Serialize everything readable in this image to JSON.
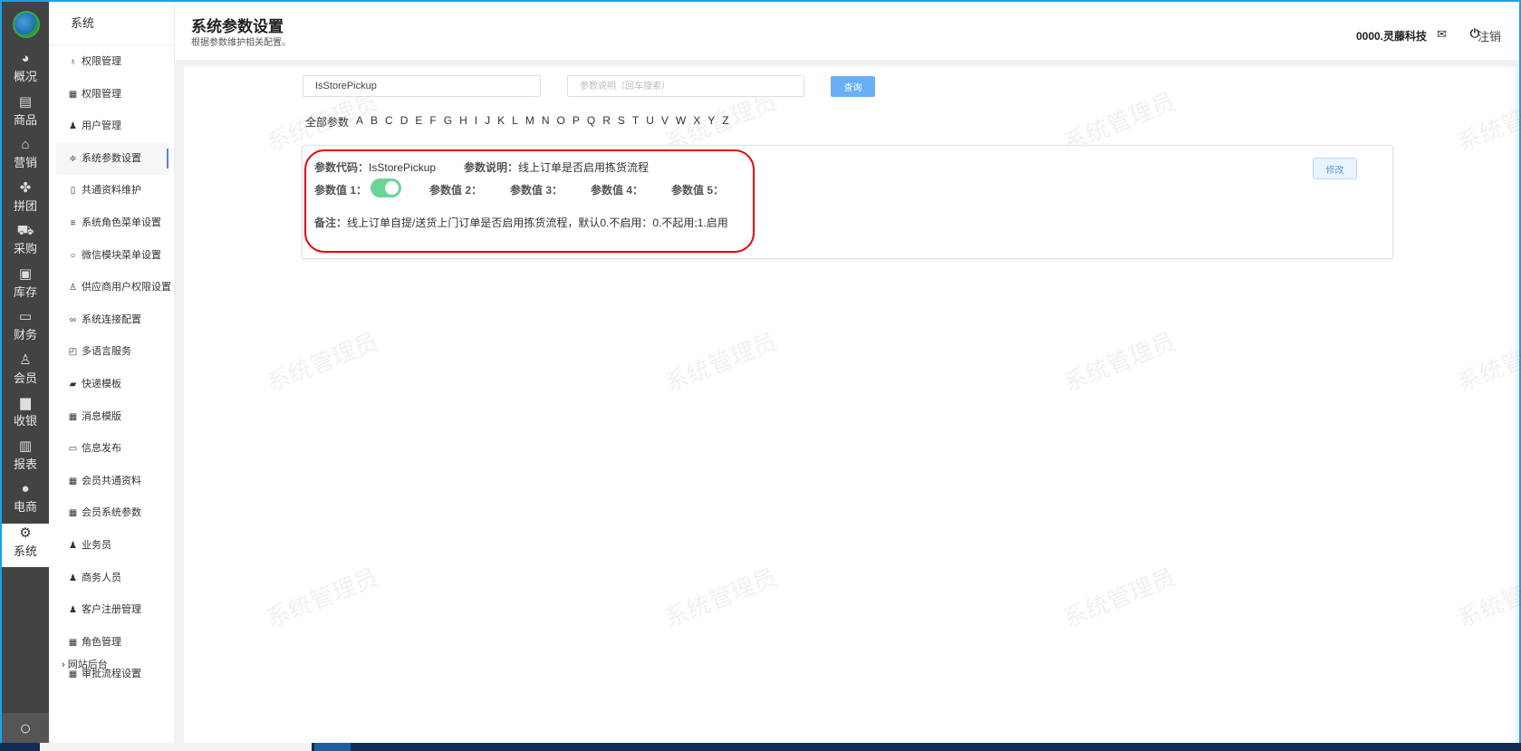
{
  "rail": {
    "items": [
      {
        "label": "概况",
        "icon": "dashboard-icon",
        "glyph": "◕"
      },
      {
        "label": "商品",
        "icon": "document-icon",
        "glyph": "▤"
      },
      {
        "label": "营销",
        "icon": "tag-icon",
        "glyph": "⌂"
      },
      {
        "label": "拼团",
        "icon": "group-icon",
        "glyph": "✤"
      },
      {
        "label": "采购",
        "icon": "cart-icon",
        "glyph": "⛟"
      },
      {
        "label": "库存",
        "icon": "box-icon",
        "glyph": "▣"
      },
      {
        "label": "财务",
        "icon": "money-icon",
        "glyph": "▭"
      },
      {
        "label": "会员",
        "icon": "user-icon",
        "glyph": "♙"
      },
      {
        "label": "收银",
        "icon": "cashier-icon",
        "glyph": "▆"
      },
      {
        "label": "报表",
        "icon": "chart-board-icon",
        "glyph": "▥"
      },
      {
        "label": "电商",
        "icon": "person-icon",
        "glyph": "●"
      },
      {
        "label": "系统",
        "icon": "gear-icon",
        "glyph": "⚙"
      }
    ],
    "search_glyph": "○"
  },
  "submenu": {
    "title": "系统",
    "items": [
      {
        "label": "权限管理",
        "icon": "key-icon",
        "glyph": "♁"
      },
      {
        "label": "权限管理",
        "icon": "grid-icon",
        "glyph": "▦"
      },
      {
        "label": "用户管理",
        "icon": "user-icon",
        "glyph": "♟"
      },
      {
        "label": "系统参数设置",
        "icon": "sliders-icon",
        "glyph": "≑"
      },
      {
        "label": "共通资料维护",
        "icon": "book-icon",
        "glyph": "▯"
      },
      {
        "label": "系统角色菜单设置",
        "icon": "menu-icon",
        "glyph": "≡"
      },
      {
        "label": "微信模块菜单设置",
        "icon": "chat-icon",
        "glyph": "○"
      },
      {
        "label": "供应商用户权限设置",
        "icon": "user-outline-icon",
        "glyph": "♙"
      },
      {
        "label": "系统连接配置",
        "icon": "link-icon",
        "glyph": "∞"
      },
      {
        "label": "多语言服务",
        "icon": "translate-icon",
        "glyph": "◰"
      },
      {
        "label": "快递模板",
        "icon": "truck-icon",
        "glyph": "▰"
      },
      {
        "label": "消息模版",
        "icon": "grid-icon",
        "glyph": "▦"
      },
      {
        "label": "信息发布",
        "icon": "message-icon",
        "glyph": "▭"
      },
      {
        "label": "会员共通资料",
        "icon": "grid-icon",
        "glyph": "▦"
      },
      {
        "label": "会员系统参数",
        "icon": "grid-icon",
        "glyph": "▦"
      },
      {
        "label": "业务员",
        "icon": "person-icon",
        "glyph": "♟"
      },
      {
        "label": "商务人员",
        "icon": "person-icon",
        "glyph": "♟"
      },
      {
        "label": "客户注册管理",
        "icon": "users-icon",
        "glyph": "♟"
      },
      {
        "label": "角色管理",
        "icon": "grid-icon",
        "glyph": "▦"
      },
      {
        "label": "审批流程设置",
        "icon": "grid-icon",
        "glyph": "▦"
      }
    ],
    "group_label": "网站后台",
    "active_index": 3
  },
  "header": {
    "title": "系统参数设置",
    "subtitle": "根据参数维护相关配置。",
    "user": "0000.灵藤科技",
    "logout": "注销"
  },
  "search": {
    "code_value": "IsStorePickup",
    "desc_placeholder": "参数说明（回车搜索）",
    "query_label": "查询"
  },
  "letters": [
    "全部参数",
    "A",
    "B",
    "C",
    "D",
    "E",
    "F",
    "G",
    "H",
    "I",
    "J",
    "K",
    "L",
    "M",
    "N",
    "O",
    "P",
    "Q",
    "R",
    "S",
    "T",
    "U",
    "V",
    "W",
    "X",
    "Y",
    "Z"
  ],
  "param": {
    "code_label": "参数代码：",
    "code": "IsStorePickup",
    "desc_label": "参数说明：",
    "desc": "线上订单是否启用拣货流程",
    "value1_label": "参数值 1：",
    "value1_on": true,
    "value2_label": "参数值 2：",
    "value3_label": "参数值 3：",
    "value4_label": "参数值 4：",
    "value5_label": "参数值 5：",
    "note_label": "备注：",
    "note": "线上订单自提/送货上门订单是否启用拣货流程，默认0.不启用：0.不起用;1.启用",
    "edit_label": "修改"
  },
  "watermark": "系统管理员"
}
